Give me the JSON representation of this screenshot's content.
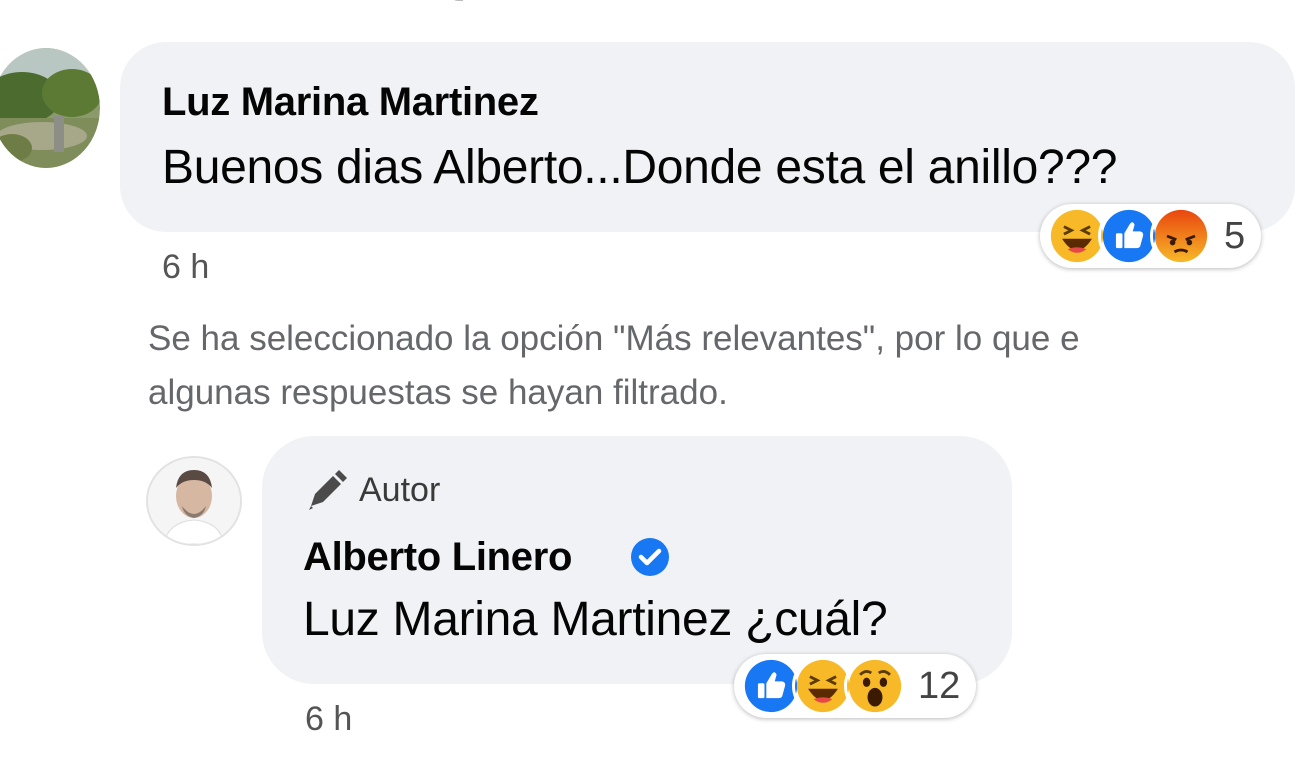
{
  "comments": [
    {
      "author": "Luz Marina Martinez",
      "text": "Buenos dias Alberto...Donde esta el anillo???",
      "time": "6 h",
      "reactions": {
        "icons": [
          "haha-icon",
          "like-icon",
          "angry-icon"
        ],
        "count": "5"
      }
    },
    {
      "badge": "Autor",
      "author": "Alberto Linero",
      "verified": true,
      "text": "Luz Marina Martinez ¿cuál?",
      "time": "6 h",
      "reactions": {
        "icons": [
          "like-icon",
          "haha-icon",
          "wow-icon"
        ],
        "count": "12"
      }
    }
  ],
  "notice": {
    "line1": "Se ha seleccionado la opción \"Más relevantes\", por lo que e",
    "line2": "algunas respuestas se hayan filtrado."
  },
  "colors": {
    "bubble": "#f0f2f5",
    "like": "#1877f2",
    "haha": "#f7b928",
    "angry": "#e9710f",
    "verified": "#1877f2",
    "muted_text": "#65676b"
  }
}
